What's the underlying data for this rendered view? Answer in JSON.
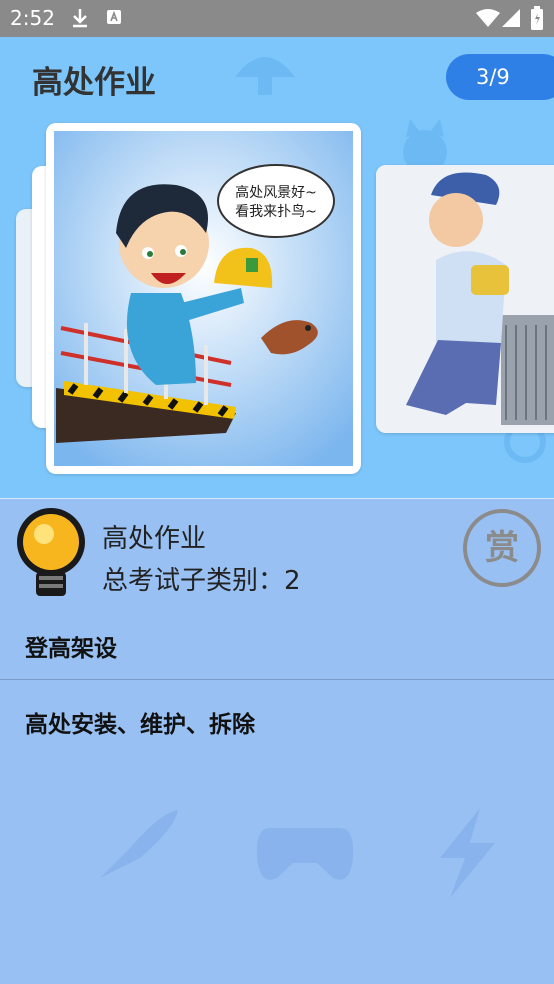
{
  "status_bar": {
    "time": "2:52"
  },
  "header": {
    "title": "高处作业",
    "counter": "3/9"
  },
  "carousel": {
    "main_card": {
      "speech_line1": "高处风景好~",
      "speech_line2": "看我来扑鸟~"
    }
  },
  "info": {
    "name": "高处作业",
    "subcategory_count": "总考试子类别：2",
    "reward_label": "赏"
  },
  "items": [
    {
      "label": "登高架设"
    },
    {
      "label": "高处安装、维护、拆除"
    }
  ],
  "colors": {
    "accent": "#2f80e6",
    "top_bg": "#7cc6fb",
    "bottom_bg": "#98c0f3"
  }
}
